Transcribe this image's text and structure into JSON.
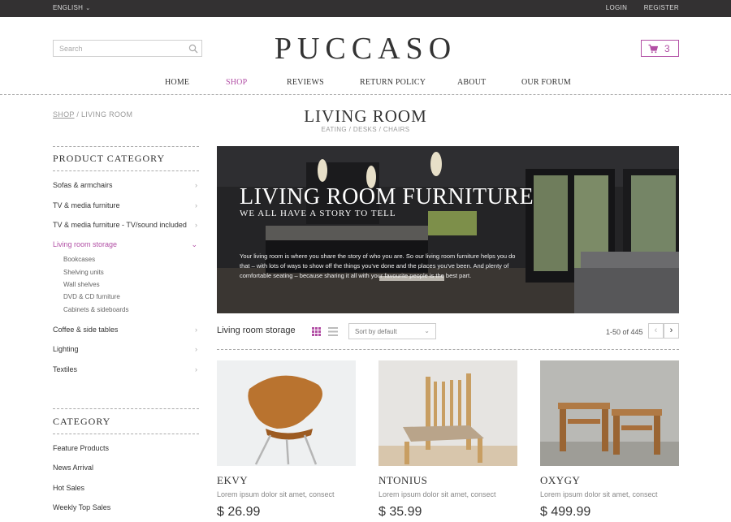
{
  "topbar": {
    "language": "ENGLISH",
    "login": "LOGIN",
    "register": "REGISTER"
  },
  "header": {
    "search_placeholder": "Search",
    "logo": "PUCCASO",
    "cart_count": "3"
  },
  "nav": [
    {
      "label": "HOME",
      "active": false
    },
    {
      "label": "SHOP",
      "active": true
    },
    {
      "label": "REVIEWS",
      "active": false
    },
    {
      "label": "RETURN POLICY",
      "active": false
    },
    {
      "label": "ABOUT",
      "active": false
    },
    {
      "label": "OUR FORUM",
      "active": false
    }
  ],
  "breadcrumb": {
    "shop": "SHOP",
    "sep": " / ",
    "current": "LIVING ROOM"
  },
  "page": {
    "title": "LIVING ROOM",
    "subtitle": "EATING / DESKS / CHAIRS"
  },
  "sidebar": {
    "product_category_title": "PRODUCT CATEGORY",
    "items": [
      {
        "label": "Sofas & armchairs"
      },
      {
        "label": "TV & media furniture"
      },
      {
        "label": "TV & media furniture - TV/sound included"
      },
      {
        "label": "Living room storage",
        "active": true
      },
      {
        "label": "Coffee & side tables"
      },
      {
        "label": "Lighting"
      },
      {
        "label": "Textiles"
      }
    ],
    "subitems": [
      "Bookcases",
      "Shelving units",
      "Wall shelves",
      "DVD & CD furniture",
      "Cabinets & sideboards"
    ],
    "category_title": "CATEGORY",
    "categories": [
      "Feature Products",
      "News Arrival",
      "Hot Sales",
      "Weekly Top Sales"
    ]
  },
  "hero": {
    "title": "LIVING ROOM FURNITURE",
    "tagline": "WE ALL HAVE A STORY TO TELL",
    "text": "Your living room is where you share the story of who you are. So our living room furniture helps you do that – with lots of ways to show off the things you've done and the places you've been. And plenty of comfortable seating – because sharing it all with your favourite people is the best part."
  },
  "toolbar": {
    "title": "Living room storage",
    "sort_label": "Sort by default",
    "range": "1-50 of 445",
    "prev": "‹",
    "next": "›"
  },
  "products": [
    {
      "name": "EKVY",
      "desc": "Lorem ipsum dolor sit amet, consect",
      "price": "$ 26.99"
    },
    {
      "name": "NTONIUS",
      "desc": "Lorem ipsum dolor sit amet, consect",
      "price": "$ 35.99"
    },
    {
      "name": "OXYGY",
      "desc": "Lorem ipsum dolor sit amet, consect",
      "price": "$ 499.99"
    }
  ],
  "colors": {
    "accent": "#b24fa5",
    "topbar": "#333132"
  },
  "icons": {
    "search": "search-icon",
    "cart": "cart-icon",
    "grid": "grid-view-icon",
    "list": "list-view-icon"
  }
}
